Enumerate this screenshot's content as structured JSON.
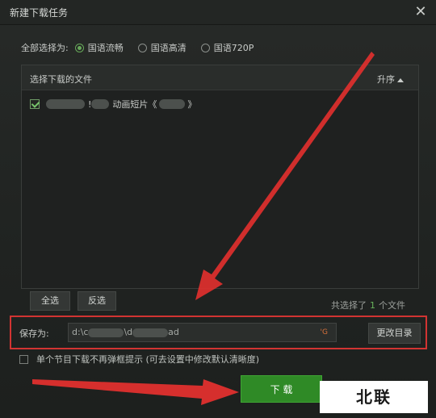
{
  "dialog": {
    "title": "新建下载任务",
    "close_symbol": "✕"
  },
  "quality": {
    "label": "全部选择为:",
    "options": [
      {
        "label": "国语流畅",
        "selected": true
      },
      {
        "label": "国语高清",
        "selected": false
      },
      {
        "label": "国语720P",
        "selected": false
      }
    ]
  },
  "file_list": {
    "header": "选择下载的文件",
    "sort_label": "升序",
    "items": [
      {
        "checked": true,
        "text_a": "!",
        "text_b": "动画短片《",
        "text_c": "》"
      }
    ]
  },
  "buttons": {
    "select_all": "全选",
    "invert": "反选",
    "change_dir": "更改目录",
    "download": "下 载"
  },
  "selection": {
    "prefix": "共选择了",
    "count": "1",
    "suffix": "个文件"
  },
  "save": {
    "label": "保存为:",
    "path_a": "d:\\c",
    "path_b": "\\d",
    "path_c": "ad",
    "size_hint": "'G"
  },
  "no_prompt": {
    "checked": false,
    "label": "单个节目下载不再弹框提示 (可去设置中修改默认清晰度)"
  },
  "watermark": "北联",
  "colors": {
    "accent_green": "#2f8a26",
    "highlight_red": "#d23432"
  }
}
